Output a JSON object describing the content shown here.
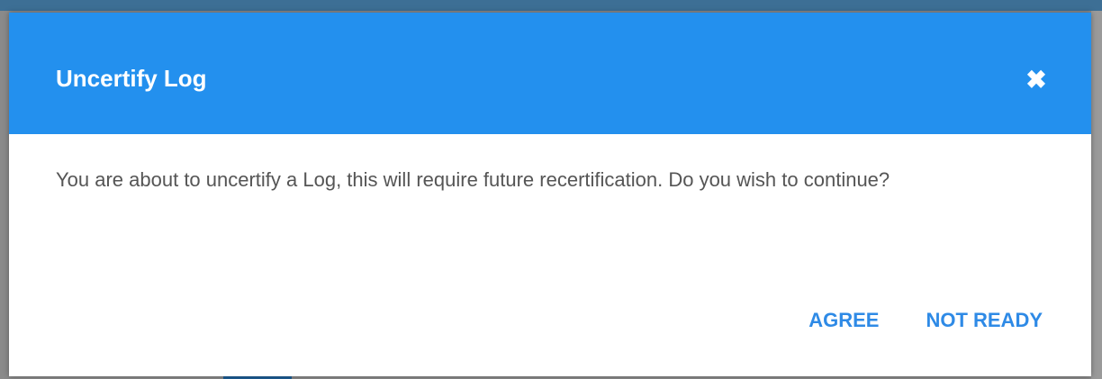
{
  "dialog": {
    "title": "Uncertify Log",
    "close_icon": "close-icon",
    "close_glyph": "✖",
    "message": "You are about to uncertify a Log, this will require future recertification. Do you wish to continue?",
    "actions": {
      "agree_label": "AGREE",
      "not_ready_label": "NOT READY"
    }
  },
  "colors": {
    "header": "#2390ee",
    "action_text": "#2e8ae6",
    "body_text": "#555555",
    "backdrop": "#8a8a8a"
  }
}
